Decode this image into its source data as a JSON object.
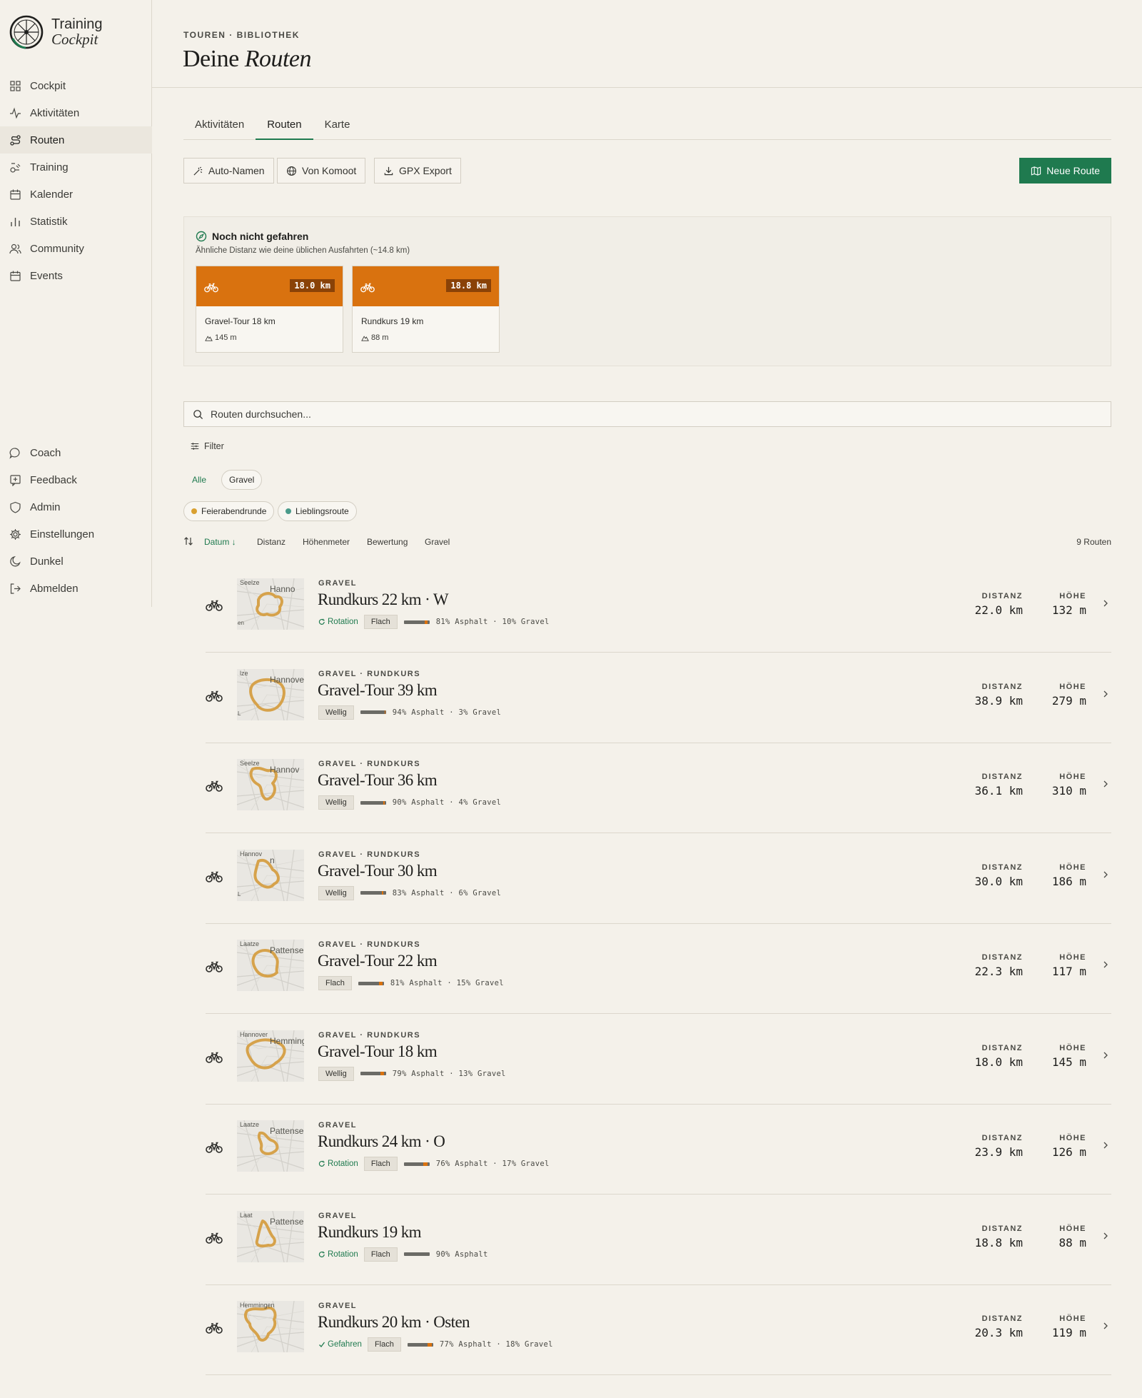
{
  "brand": {
    "line1": "Training",
    "line2": "Cockpit"
  },
  "sidebar": {
    "items": [
      {
        "label": "Cockpit",
        "icon": "grid-icon"
      },
      {
        "label": "Aktivitäten",
        "icon": "activity-icon"
      },
      {
        "label": "Routen",
        "icon": "route-icon",
        "active": true
      },
      {
        "label": "Training",
        "icon": "training-icon"
      },
      {
        "label": "Kalender",
        "icon": "calendar-icon"
      },
      {
        "label": "Statistik",
        "icon": "bar-chart-icon"
      },
      {
        "label": "Community",
        "icon": "users-icon"
      },
      {
        "label": "Events",
        "icon": "calendar-icon"
      }
    ],
    "bottom_items": [
      {
        "label": "Coach",
        "icon": "chat-icon"
      },
      {
        "label": "Feedback",
        "icon": "feedback-icon"
      },
      {
        "label": "Admin",
        "icon": "shield-icon"
      },
      {
        "label": "Einstellungen",
        "icon": "gear-icon"
      },
      {
        "label": "Dunkel",
        "icon": "moon-icon"
      },
      {
        "label": "Abmelden",
        "icon": "logout-icon"
      }
    ]
  },
  "header": {
    "breadcrumb": "TOUREN · BIBLIOTHEK",
    "title_plain": "Deine",
    "title_italic": "Routen"
  },
  "tabs": [
    {
      "label": "Aktivitäten"
    },
    {
      "label": "Routen",
      "active": true
    },
    {
      "label": "Karte"
    }
  ],
  "toolbar": {
    "auto_names": "Auto-Namen",
    "komoot": "Von Komoot",
    "gpx": "GPX Export",
    "new_route": "Neue Route"
  },
  "suggestions": {
    "title": "Noch nicht gefahren",
    "subtitle": "Ähnliche Distanz wie deine üblichen Ausfahrten (~14.8 km)",
    "cards": [
      {
        "km": "18.0 km",
        "name": "Gravel-Tour 18 km",
        "elev": "145 m"
      },
      {
        "km": "18.8 km",
        "name": "Rundkurs 19 km",
        "elev": "88 m"
      }
    ]
  },
  "search": {
    "placeholder": "Routen durchsuchen..."
  },
  "filter": {
    "label": "Filter"
  },
  "chips": {
    "types": [
      "Alle",
      "Gravel"
    ],
    "tags": [
      {
        "label": "Feierabendrunde",
        "color": "#d9a030"
      },
      {
        "label": "Lieblingsroute",
        "color": "#4a9a8a"
      }
    ]
  },
  "sort": {
    "date": "Datum ↓",
    "distance": "Distanz",
    "elevation": "Höhenmeter",
    "rating": "Bewertung",
    "gravel": "Gravel",
    "count": "9 Routen"
  },
  "labels": {
    "distance": "DISTANZ",
    "elevation": "HÖHE"
  },
  "routes": [
    {
      "kicker": "GRAVEL",
      "name": "Rundkurs 22 km · W",
      "status": "Rotation",
      "terrain": "Flach",
      "asphalt": 0.81,
      "gravel": 0.1,
      "surface": "81% Asphalt · 10% Gravel",
      "distance": "22.0 km",
      "elevation": "132 m"
    },
    {
      "kicker": "GRAVEL · RUNDKURS",
      "name": "Gravel-Tour 39 km",
      "status": "",
      "terrain": "Wellig",
      "asphalt": 0.94,
      "gravel": 0.03,
      "surface": "94% Asphalt · 3% Gravel",
      "distance": "38.9 km",
      "elevation": "279 m"
    },
    {
      "kicker": "GRAVEL · RUNDKURS",
      "name": "Gravel-Tour 36 km",
      "status": "",
      "terrain": "Wellig",
      "asphalt": 0.9,
      "gravel": 0.04,
      "surface": "90% Asphalt · 4% Gravel",
      "distance": "36.1 km",
      "elevation": "310 m"
    },
    {
      "kicker": "GRAVEL · RUNDKURS",
      "name": "Gravel-Tour 30 km",
      "status": "",
      "terrain": "Wellig",
      "asphalt": 0.83,
      "gravel": 0.06,
      "surface": "83% Asphalt · 6% Gravel",
      "distance": "30.0 km",
      "elevation": "186 m"
    },
    {
      "kicker": "GRAVEL · RUNDKURS",
      "name": "Gravel-Tour 22 km",
      "status": "",
      "terrain": "Flach",
      "asphalt": 0.81,
      "gravel": 0.15,
      "surface": "81% Asphalt · 15% Gravel",
      "distance": "22.3 km",
      "elevation": "117 m"
    },
    {
      "kicker": "GRAVEL · RUNDKURS",
      "name": "Gravel-Tour 18 km",
      "status": "",
      "terrain": "Wellig",
      "asphalt": 0.79,
      "gravel": 0.13,
      "surface": "79% Asphalt · 13% Gravel",
      "distance": "18.0 km",
      "elevation": "145 m"
    },
    {
      "kicker": "GRAVEL",
      "name": "Rundkurs 24 km · O",
      "status": "Rotation",
      "terrain": "Flach",
      "asphalt": 0.76,
      "gravel": 0.17,
      "surface": "76% Asphalt · 17% Gravel",
      "distance": "23.9 km",
      "elevation": "126 m"
    },
    {
      "kicker": "GRAVEL",
      "name": "Rundkurs 19 km",
      "status": "Rotation",
      "terrain": "Flach",
      "asphalt": 0.9,
      "gravel": 0.0,
      "surface": "90% Asphalt",
      "distance": "18.8 km",
      "elevation": "88 m"
    },
    {
      "kicker": "GRAVEL",
      "name": "Rundkurs 20 km · Osten",
      "status": "Gefahren",
      "terrain": "Flach",
      "asphalt": 0.77,
      "gravel": 0.18,
      "surface": "77% Asphalt · 18% Gravel",
      "distance": "20.3 km",
      "elevation": "119 m"
    }
  ],
  "map_labels": [
    [
      "Seelze",
      "Hanno",
      "en"
    ],
    [
      "lze",
      "Hannover",
      "L"
    ],
    [
      "Seelze",
      "Hannov",
      ""
    ],
    [
      "Hannov",
      "n",
      "L"
    ],
    [
      "Laatze",
      "Pattensen",
      ""
    ],
    [
      "Hannover",
      "Hemmingen",
      ""
    ],
    [
      "Laatze",
      "Pattensen",
      ""
    ],
    [
      "Laat",
      "Pattensen",
      ""
    ],
    [
      "Hemmingen",
      "",
      ""
    ]
  ]
}
